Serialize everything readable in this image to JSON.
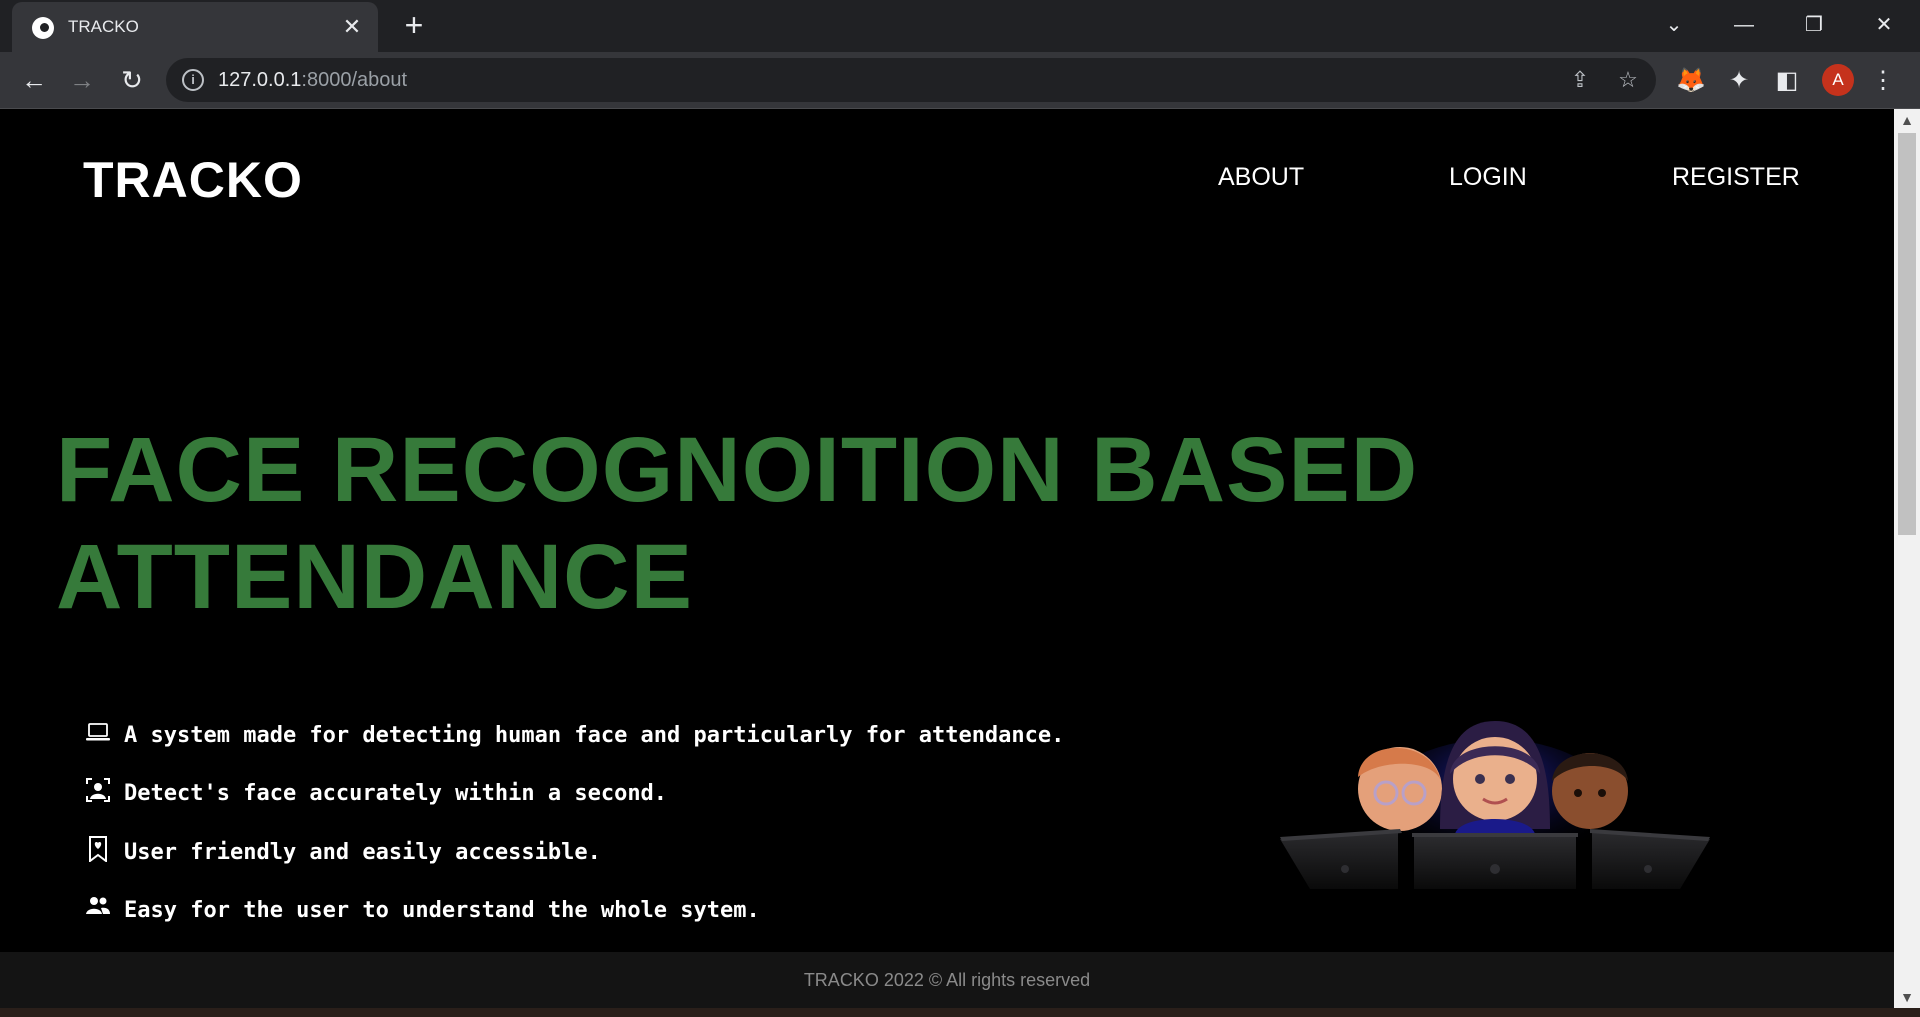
{
  "browser": {
    "tab_title": "TRACKO",
    "url_host": "127.0.0.1",
    "url_rest": ":8000/about",
    "controls": {
      "minimize": "—",
      "restore": "❐",
      "close": "✕",
      "tab_search": "⌄"
    },
    "avatar_letter": "A",
    "accent_color": "#c5321c"
  },
  "site": {
    "brand": "TRACKO",
    "nav": {
      "about": "ABOUT",
      "login": "LOGIN",
      "register": "REGISTER"
    },
    "hero": {
      "line1": "FACE RECOGNOITION BASED",
      "line2": "ATTENDANCE",
      "color": "#367a3a"
    },
    "features": [
      {
        "icon": "laptop-icon",
        "text": "A system made for detecting human face and particularly for attendance."
      },
      {
        "icon": "person-bounding-box-icon",
        "text": "Detect's face accurately within a second."
      },
      {
        "icon": "bookmark-heart-icon",
        "text": "User friendly and easily accessible."
      },
      {
        "icon": "people-icon",
        "text": "Easy for the user to understand the whole sytem."
      }
    ],
    "footer": "TRACKO 2022 © All rights reserved"
  }
}
